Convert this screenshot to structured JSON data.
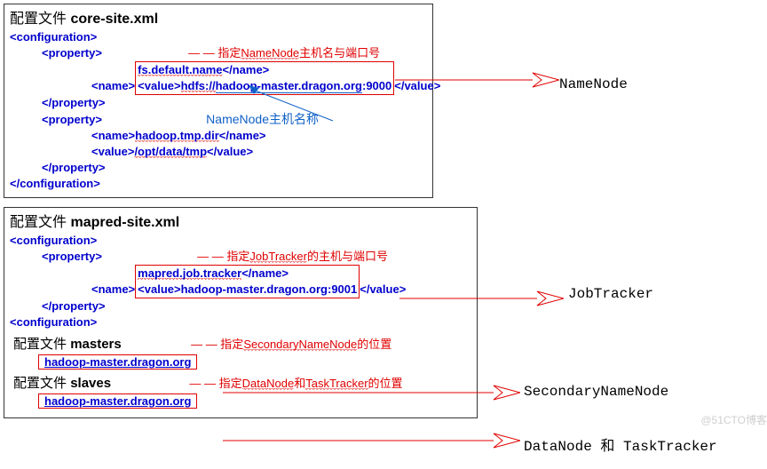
{
  "panel1": {
    "title_prefix": "配置文件",
    "title_file": "core-site.xml",
    "cfg_open": "<configuration>",
    "prop_open": "<property>",
    "comment1": "— — 指定NameNode主机名与端口号",
    "name1_open": "<name>",
    "name1_val": "fs.default.name",
    "name1_close": "</name>",
    "value1_open": "<value>",
    "value1_scheme": "hdfs://",
    "value1_host": "hadoop-master.dragon.org",
    "value1_port": ":9000",
    "value1_close": "</value>",
    "prop_close": "</property>",
    "prop2_open": "<property>",
    "hostlabel": "NameNode主机名称",
    "name2_open": "<name>",
    "name2_val": "hadoop.tmp.dir",
    "name2_close": "</name>",
    "value2_open": "<value>",
    "value2_val": "/opt/data/tmp",
    "value2_close": "</value>",
    "cfg_close": "</configuration>"
  },
  "panel2": {
    "title_prefix": "配置文件",
    "title_file": "mapred-site.xml",
    "cfg_open": "<configuration>",
    "prop_open": "<property>",
    "comment1": "— — 指定JobTracker的主机与端口号",
    "name1_open": "<name>",
    "name1_val": "mapred.job.tracker",
    "name1_close": "</name>",
    "value1_open": "<value>",
    "value1_host": "hadoop-master.dragon.org:9001",
    "value1_close": "</value>",
    "prop_close": "</property>",
    "cfg_mid": "<configuration>",
    "masters_prefix": "配置文件",
    "masters_file": "masters",
    "comment_masters": "— — 指定SecondaryNameNode的位置",
    "masters_host": "hadoop-master.dragon.org",
    "slaves_prefix": "配置文件",
    "slaves_file": "slaves",
    "comment_slaves": "— — 指定DataNode和TaskTracker的位置",
    "slaves_host": "hadoop-master.dragon.org"
  },
  "labels": {
    "namenode": "NameNode",
    "jobtracker": "JobTracker",
    "secondary": "SecondaryNameNode",
    "datanode": "DataNode 和 TaskTracker"
  },
  "watermark": "@51CTO博客"
}
